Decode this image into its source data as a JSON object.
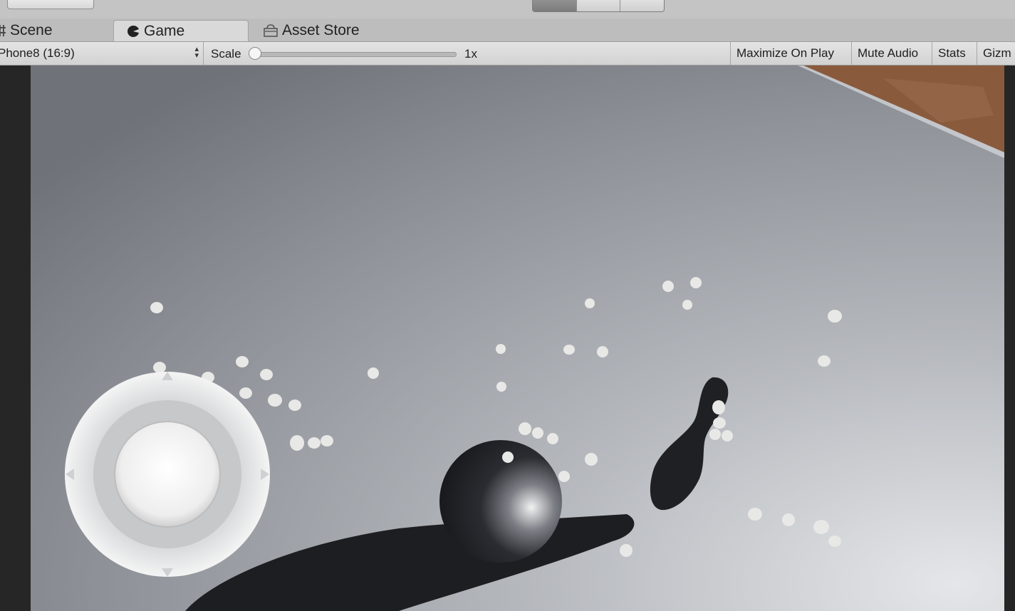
{
  "window": {
    "tabs": [
      {
        "label": "Scene",
        "icon": "scene-icon"
      },
      {
        "label": "Game",
        "icon": "game-icon",
        "selected": true
      },
      {
        "label": "Asset Store",
        "icon": "asset-store-icon"
      }
    ]
  },
  "toolbar": {
    "aspect": "Phone8 (16:9)",
    "scale_label": "Scale",
    "scale_value": "1x",
    "maximize_on_play": "Maximize On Play",
    "mute_audio": "Mute Audio",
    "stats": "Stats",
    "gizmos": "Gizm"
  },
  "play_controls": {
    "play_active": true
  },
  "colors": {
    "editor_bg": "#c2c2c2",
    "floor_light": "#d8dadd",
    "floor_dark": "#7f8389",
    "ball": "#1f2126",
    "wood": "#8a5a3c",
    "particle": "#e8e8e6"
  }
}
